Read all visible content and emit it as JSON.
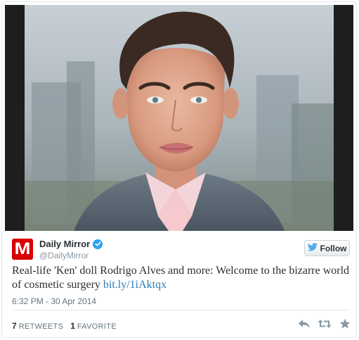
{
  "author": {
    "logo_letter": "M",
    "name": "Daily Mirror",
    "handle": "@DailyMirror"
  },
  "follow_button": {
    "label": "Follow"
  },
  "tweet": {
    "text": "Real-life 'Ken' doll Rodrigo Alves and more: Welcome to the bizarre world of cosmetic surgery ",
    "link": "bit.ly/1iAktqx",
    "timestamp": "6:32 PM - 30 Apr 2014"
  },
  "stats": {
    "retweets_count": "7",
    "retweets_label": "RETWEETS",
    "favorites_count": "1",
    "favorites_label": "FAVORITE"
  },
  "colors": {
    "link": "#2b7bb9",
    "verified": "#2fa3ef",
    "logo_bg": "#d80000",
    "twitter_bird": "#55acee"
  },
  "icons": {
    "verified": "verified-badge-icon",
    "follow": "twitter-bird-icon",
    "reply": "reply-icon",
    "retweet": "retweet-icon",
    "favorite": "star-icon"
  }
}
